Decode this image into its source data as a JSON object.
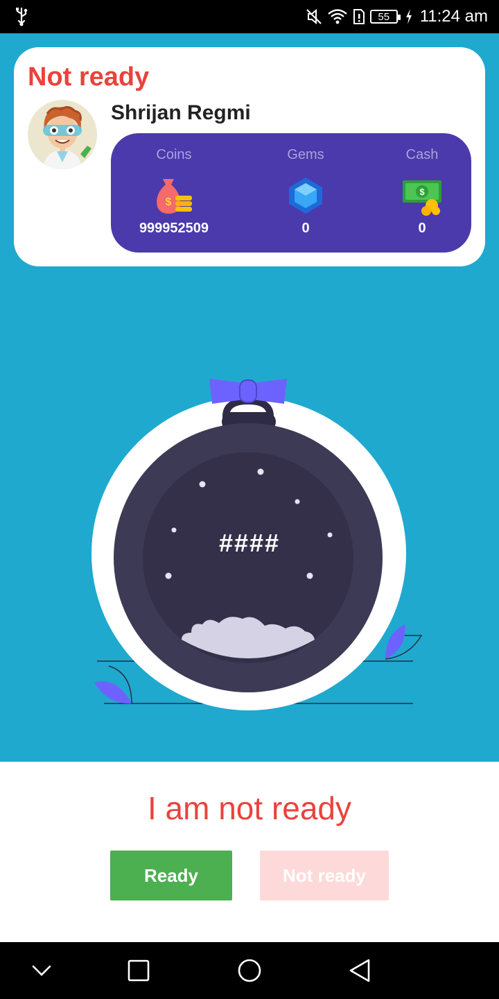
{
  "status_bar": {
    "battery_level": "55",
    "time": "11:24 am",
    "icons": [
      "usb-icon",
      "mute-icon",
      "wifi-icon",
      "sim-icon",
      "battery-icon",
      "charging-icon"
    ]
  },
  "profile": {
    "status_heading": "Not ready",
    "user_name": "Shrijan Regmi",
    "stats": [
      {
        "label": "Coins",
        "value": "999952509",
        "icon": "money-bag-icon"
      },
      {
        "label": "Gems",
        "value": "0",
        "icon": "gem-icon"
      },
      {
        "label": "Cash",
        "value": "0",
        "icon": "cash-icon"
      }
    ],
    "colors": {
      "status": "#e9433c",
      "panel": "#4b3aab"
    }
  },
  "illustration": {
    "code_text": "####"
  },
  "bottom_sheet": {
    "message": "I am not ready",
    "ready_button": "Ready",
    "not_ready_button": "Not ready",
    "colors": {
      "ready": "#4caf50",
      "not_ready": "#fddad9"
    }
  },
  "nav_bar": {
    "buttons": [
      "chevron-down-icon",
      "recents-square-icon",
      "home-circle-icon",
      "back-triangle-icon"
    ]
  }
}
